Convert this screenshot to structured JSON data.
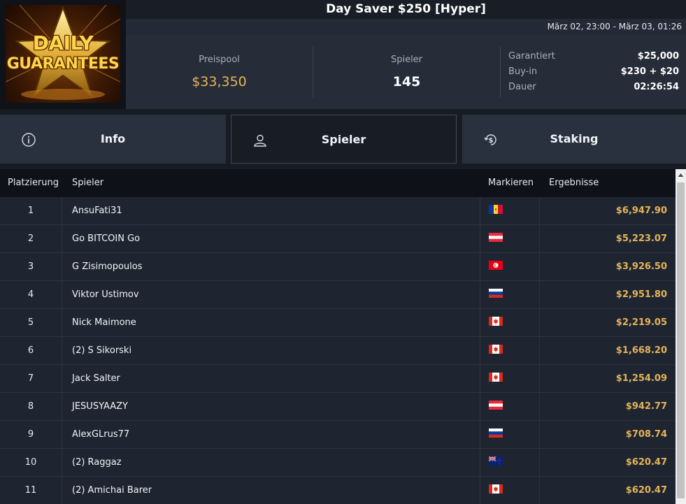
{
  "header": {
    "title": "Day Saver $250 [Hyper]",
    "dates": "März 02, 23:00 - März 03, 01:26"
  },
  "logo": {
    "line1": "DAILY",
    "line2": "GUARANTEES"
  },
  "stats": {
    "pool_label": "Preispool",
    "pool_value": "$33,350",
    "players_label": "Spieler",
    "players_value": "145",
    "details": [
      {
        "label": "Garantiert",
        "value": "$25,000"
      },
      {
        "label": "Buy-in",
        "value": "$230 + $20"
      },
      {
        "label": "Dauer",
        "value": "02:26:54"
      }
    ]
  },
  "tabs": {
    "info": "Info",
    "players": "Spieler",
    "staking": "Staking",
    "active": "players"
  },
  "table": {
    "headers": {
      "rank": "Platzierung",
      "player": "Spieler",
      "mark": "Markieren",
      "result": "Ergebnisse"
    },
    "rows": [
      {
        "rank": "1",
        "name": "AnsuFati31",
        "flag": "andorra",
        "result": "$6,947.90"
      },
      {
        "rank": "2",
        "name": "Go BITCOIN Go",
        "flag": "austria",
        "result": "$5,223.07"
      },
      {
        "rank": "3",
        "name": "G Zisimopoulos",
        "flag": "tunisia",
        "result": "$3,926.50"
      },
      {
        "rank": "4",
        "name": "Viktor Ustimov",
        "flag": "russia",
        "result": "$2,951.80"
      },
      {
        "rank": "5",
        "name": "Nick Maimone",
        "flag": "canada",
        "result": "$2,219.05"
      },
      {
        "rank": "6",
        "name": "(2) S Sikorski",
        "flag": "canada",
        "result": "$1,668.20"
      },
      {
        "rank": "7",
        "name": "Jack Salter",
        "flag": "canada",
        "result": "$1,254.09"
      },
      {
        "rank": "8",
        "name": "JESUSYAAZY",
        "flag": "austria",
        "result": "$942.77"
      },
      {
        "rank": "9",
        "name": "AlexGLrus77",
        "flag": "russia",
        "result": "$708.74"
      },
      {
        "rank": "10",
        "name": "(2) Raggaz",
        "flag": "new-zealand",
        "result": "$620.47"
      },
      {
        "rank": "11",
        "name": "(2) Amichai Barer",
        "flag": "canada",
        "result": "$620.47"
      }
    ]
  },
  "colors": {
    "accent_gold": "#e5b45a",
    "background": "#161b24",
    "panel": "#262d39"
  }
}
